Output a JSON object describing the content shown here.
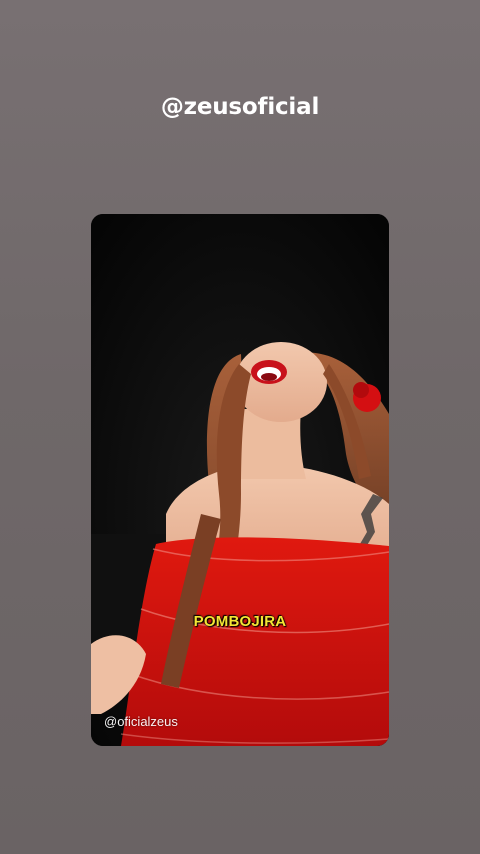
{
  "story": {
    "username": "@zeusoficial"
  },
  "video": {
    "caption": "POMBOJIRA",
    "watermark": "@oficialzeus"
  },
  "colors": {
    "background": "#736c6d",
    "caption": "#f5e534",
    "dress": "#d4100f"
  }
}
